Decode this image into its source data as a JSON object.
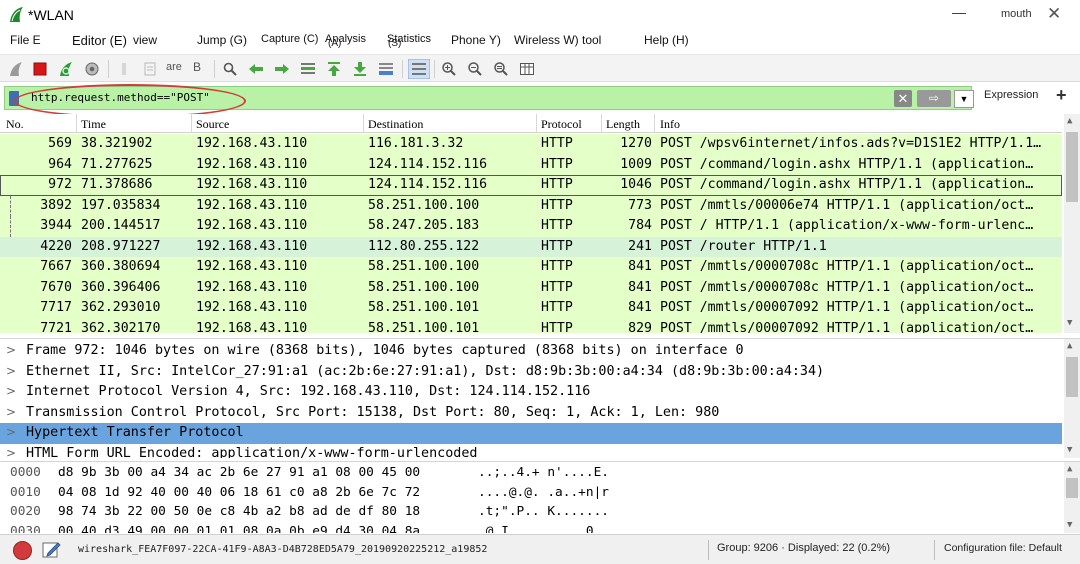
{
  "window": {
    "title": "*WLAN",
    "minimize_glyph": "—",
    "user": "mouth",
    "close_glyph": "✕"
  },
  "menu": [
    "File E",
    "Editor (E)",
    "view",
    "Jump (G)",
    "Capture (C)",
    "Analysis",
    "Statistics",
    "Phone Y)",
    "Wireless W)",
    "tool",
    "Help (H)"
  ],
  "menu_subs": [
    "(A)",
    "(S)"
  ],
  "toolbar_text": [
    "are",
    "B"
  ],
  "filter": {
    "value": "http.request.method==\"POST\"",
    "clear_glyph": "✕",
    "apply_glyph": "⇨",
    "dropdown_glyph": "▼",
    "expression_label": "Expression",
    "add_glyph": "+"
  },
  "columns": [
    "No.",
    "Time",
    "Source",
    "Destination",
    "Protocol",
    "Length",
    "Info"
  ],
  "packets": [
    {
      "no": "569",
      "time": "38.321902",
      "src": "192.168.43.110",
      "dst": "116.181.3.32",
      "proto": "HTTP",
      "len": "1270",
      "info": "POST /wpsv6internet/infos.ads?v=D1S1E2 HTTP/1.1…",
      "bg": "#e4ffc7"
    },
    {
      "no": "964",
      "time": "71.277625",
      "src": "192.168.43.110",
      "dst": "124.114.152.116",
      "proto": "HTTP",
      "len": "1009",
      "info": "POST /command/login.ashx HTTP/1.1  (application…",
      "bg": "#e4ffc7"
    },
    {
      "no": "972",
      "time": "71.378686",
      "src": "192.168.43.110",
      "dst": "124.114.152.116",
      "proto": "HTTP",
      "len": "1046",
      "info": "POST /command/login.ashx HTTP/1.1  (application…",
      "bg": "#e4ffc7",
      "selected": true
    },
    {
      "no": "3892",
      "time": "197.035834",
      "src": "192.168.43.110",
      "dst": "58.251.100.100",
      "proto": "HTTP",
      "len": "773",
      "info": "POST /mmtls/00006e74 HTTP/1.1  (application/oct…",
      "bg": "#e4ffc7"
    },
    {
      "no": "3944",
      "time": "200.144517",
      "src": "192.168.43.110",
      "dst": "58.247.205.183",
      "proto": "HTTP",
      "len": "784",
      "info": "POST / HTTP/1.1  (application/x-www-form-urlenc…",
      "bg": "#e4ffc7"
    },
    {
      "no": "4220",
      "time": "208.971227",
      "src": "192.168.43.110",
      "dst": "112.80.255.122",
      "proto": "HTTP",
      "len": "241",
      "info": "POST /router HTTP/1.1",
      "bg": "#d6f2d9"
    },
    {
      "no": "7667",
      "time": "360.380694",
      "src": "192.168.43.110",
      "dst": "58.251.100.100",
      "proto": "HTTP",
      "len": "841",
      "info": "POST /mmtls/0000708c HTTP/1.1  (application/oct…",
      "bg": "#e4ffc7"
    },
    {
      "no": "7670",
      "time": "360.396406",
      "src": "192.168.43.110",
      "dst": "58.251.100.100",
      "proto": "HTTP",
      "len": "841",
      "info": "POST /mmtls/0000708c HTTP/1.1  (application/oct…",
      "bg": "#e4ffc7"
    },
    {
      "no": "7717",
      "time": "362.293010",
      "src": "192.168.43.110",
      "dst": "58.251.100.101",
      "proto": "HTTP",
      "len": "841",
      "info": "POST /mmtls/00007092 HTTP/1.1  (application/oct…",
      "bg": "#e4ffc7"
    },
    {
      "no": "7721",
      "time": "362.302170",
      "src": "192.168.43.110",
      "dst": "58.251.100.101",
      "proto": "HTTP",
      "len": "829",
      "info": "POST /mmtls/00007092 HTTP/1.1  (application/oct…",
      "bg": "#e4ffc7"
    }
  ],
  "details": [
    {
      "text": "Frame 972: 1046 bytes on wire (8368 bits), 1046 bytes captured (8368 bits) on interface 0"
    },
    {
      "text": "Ethernet II, Src: IntelCor_27:91:a1 (ac:2b:6e:27:91:a1), Dst: d8:9b:3b:00:a4:34 (d8:9b:3b:00:a4:34)"
    },
    {
      "text": "Internet Protocol Version 4, Src: 192.168.43.110, Dst: 124.114.152.116"
    },
    {
      "text": "Transmission Control Protocol, Src Port: 15138, Dst Port: 80, Seq: 1, Ack: 1, Len: 980"
    },
    {
      "text": "Hypertext Transfer Protocol",
      "selected": true
    },
    {
      "text": "HTML Form URL Encoded: application/x-www-form-urlencoded"
    }
  ],
  "detail_chevron": ">",
  "bytes": [
    {
      "offset": "0000",
      "hex": "d8 9b 3b 00 a4 34 ac 2b  6e 27 91 a1 08 00 45 00",
      "ascii": "..;..4.+ n'....E."
    },
    {
      "offset": "0010",
      "hex": "04 08 1d 92 40 00 40 06  18 61 c0 a8 2b 6e 7c 72",
      "ascii": "....@.@. .a..+n|r"
    },
    {
      "offset": "0020",
      "hex": "98 74 3b 22 00 50 0e c8  4b a2 b8 ad de df 80 18",
      "ascii": ".t;\".P.. K......."
    },
    {
      "offset": "0030",
      "hex": "00 40 d3 49 00 00 01 01  08 0a 0b e9 d4 30 04 8a",
      "ascii": ".@.I.... .....0.."
    }
  ],
  "status": {
    "file": "wireshark_FEA7F097-22CA-41F9-A8A3-D4B728ED5A79_20190920225212_a19852",
    "counts": "Group: 9206 · Displayed: 22 (0.2%)",
    "profile": "Configuration file: Default"
  },
  "colors": {
    "filter_valid": "#b9f1a6",
    "http_row": "#e4ffc7",
    "selected_detail": "#6aa4de",
    "annotation_ring": "#d43c3c"
  }
}
